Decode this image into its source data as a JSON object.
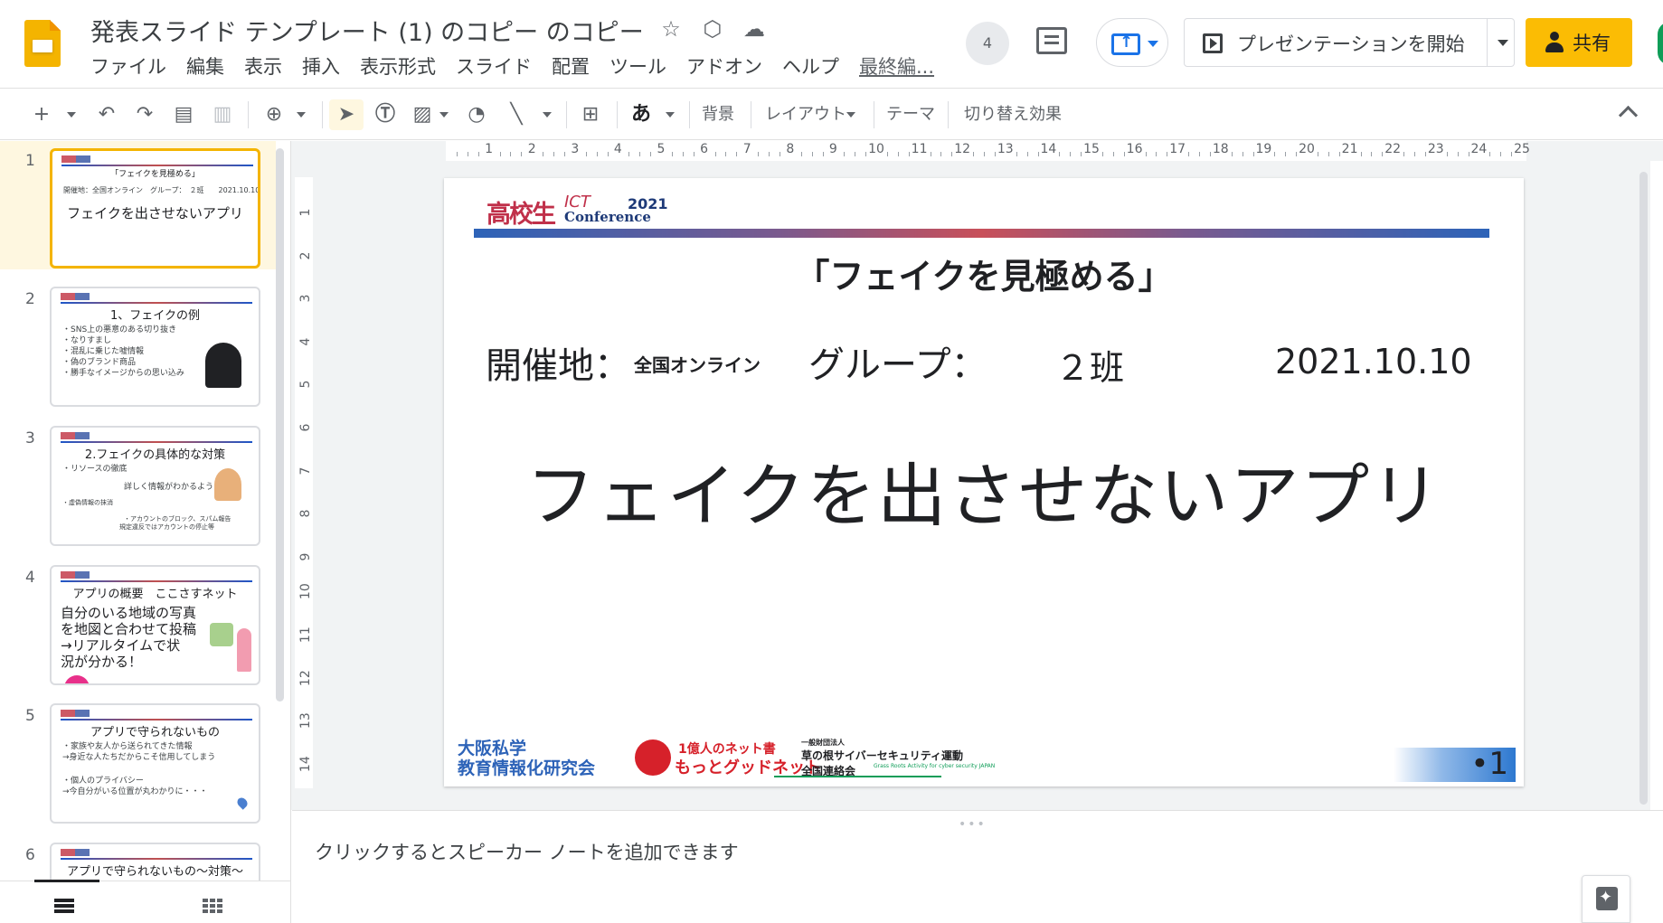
{
  "header": {
    "title": "発表スライド テンプレート (1) のコピー のコピー",
    "menus": [
      "ファイル",
      "編集",
      "表示",
      "挿入",
      "表示形式",
      "スライド",
      "配置",
      "ツール",
      "アドオン",
      "ヘルプ"
    ],
    "last_edit": "最終編...",
    "collaborator_count": "4",
    "present_label": "プレゼンテーションを開始",
    "share_label": "共有"
  },
  "toolbar": {
    "text_style_glyph": "あ",
    "background_label": "背景",
    "layout_label": "レイアウト",
    "theme_label": "テーマ",
    "transition_label": "切り替え効果"
  },
  "ruler": {
    "h_numbers": [
      "1",
      "2",
      "3",
      "4",
      "5",
      "6",
      "7",
      "8",
      "9",
      "10",
      "11",
      "12",
      "13",
      "14",
      "15",
      "16",
      "17",
      "18",
      "19",
      "20",
      "21",
      "22",
      "23",
      "24",
      "25"
    ],
    "v_numbers": [
      "1",
      "2",
      "3",
      "4",
      "5",
      "6",
      "7",
      "8",
      "9",
      "10",
      "11",
      "12",
      "13",
      "14"
    ]
  },
  "filmstrip": {
    "slides": [
      {
        "num": "1",
        "title": "「フェイクを見極める」",
        "lines": [
          "開催地：全国オンライン　グループ：　２班　　2021.10.10"
        ],
        "big": "フェイクを出させないアプリ"
      },
      {
        "num": "2",
        "title": "1、フェイクの例",
        "lines": [
          "・SNS上の悪意のある切り抜き",
          "・なりすまし",
          "・混乱に乗じた嘘情報",
          "・偽のブランド商品",
          "・勝手なイメージからの思い込み"
        ],
        "big": ""
      },
      {
        "num": "3",
        "title": "2.フェイクの具体的な対策",
        "lines": [
          "・リソースの徹底",
          "詳しく情報がわかるように！",
          "・虚偽情報の抹消",
          "・アカウントのブロック、スパム報告",
          "規定違反ではアカウントの停止等"
        ],
        "big": ""
      },
      {
        "num": "4",
        "title": "アプリの概要　ここさすネット",
        "lines": [],
        "big": "自分のいる地域の写真\nを地図と合わせて投稿\n→リアルタイムで状\n況が分かる！"
      },
      {
        "num": "5",
        "title": "アプリで守られないもの",
        "lines": [
          "・家族や友人から送られてきた情報",
          "→身近な人たちだからこそ信用してしまう",
          "",
          "・個人のプライバシー",
          "→今自分がいる位置が丸わかりに・・・"
        ],
        "big": ""
      },
      {
        "num": "6",
        "title": "アプリで守られないもの〜対策〜",
        "lines": [],
        "big": ""
      }
    ]
  },
  "slide": {
    "logo_main": "高校生",
    "logo_ict": "ICT",
    "logo_conf": "Conference",
    "logo_year": "2021",
    "title": "「フェイクを見極める」",
    "venue_label": "開催地：",
    "venue_value": "全国オンライン",
    "group_label": "グループ：",
    "group_value": "２班",
    "date": "2021.10.10",
    "app_name": "フェイクを出させないアプリ",
    "footer_org_line1": "大阪私学",
    "footer_org_line2": "教育情報化研究会",
    "footer_net_line1": "1億人のネット書",
    "footer_net_line2": "もっとグッドネット",
    "footer_cyber_small": "一般財団法人",
    "footer_cyber_line1": "草の根サイバーセキュリティ運動",
    "footer_cyber_line2": "全国連絡会",
    "footer_cyber_tag": "Grass Roots Activity for cyber security JAPAN",
    "page_number": "•1"
  },
  "notes": {
    "placeholder": "クリックするとスピーカー ノートを追加できます"
  },
  "colors": {
    "accent": "#fbbc04",
    "selection": "#fef7e0",
    "link_blue": "#1a73e8"
  }
}
